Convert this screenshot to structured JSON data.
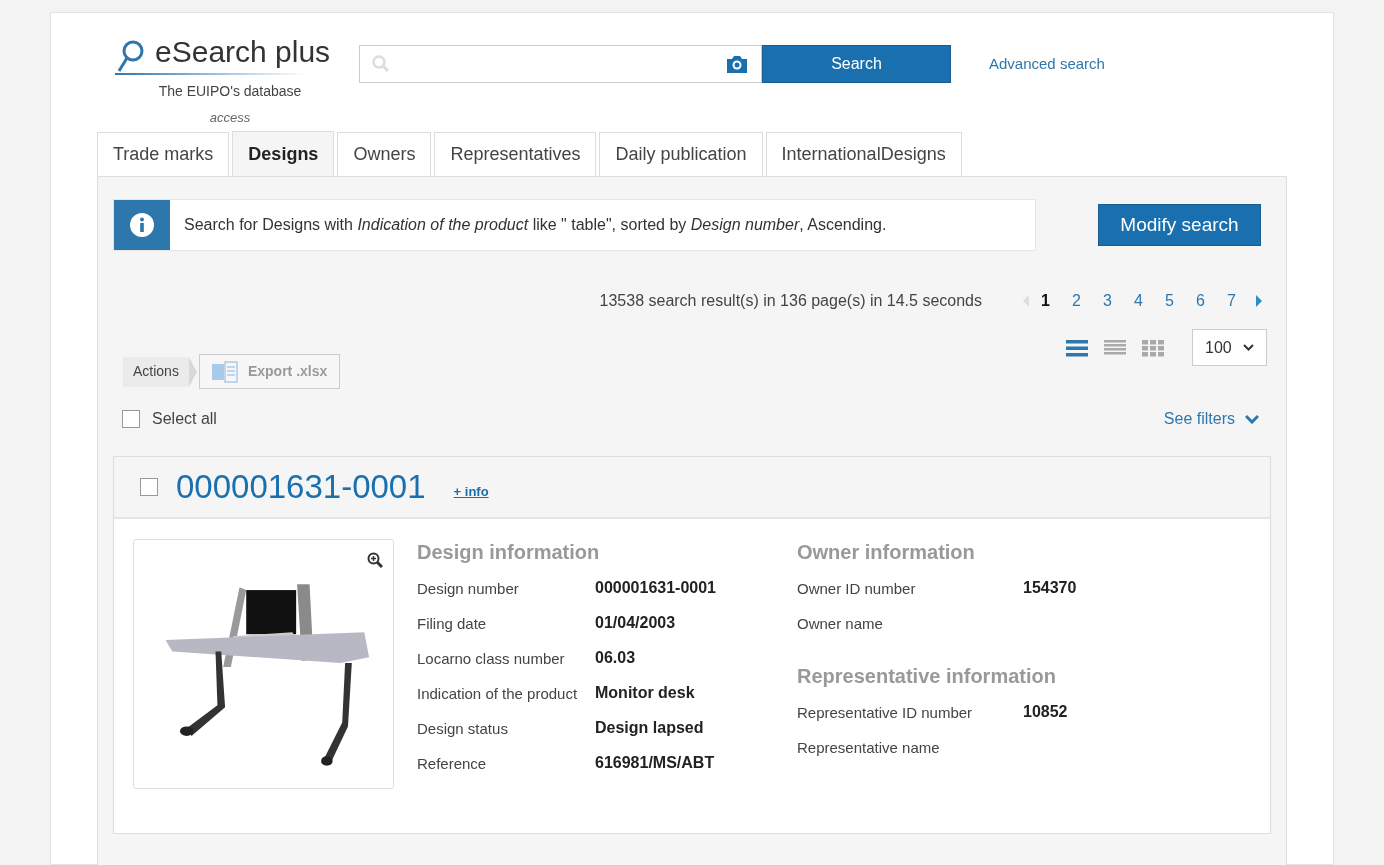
{
  "logo": {
    "title": "eSearch plus",
    "subtitle": "The EUIPO's database",
    "subtitle2": "access"
  },
  "search": {
    "button": "Search",
    "advanced": "Advanced search"
  },
  "tabs": [
    {
      "label": "Trade marks",
      "selected": false
    },
    {
      "label": "Designs",
      "selected": true
    },
    {
      "label": "Owners",
      "selected": false
    },
    {
      "label": "Representatives",
      "selected": false
    },
    {
      "label": "Daily publication",
      "selected": false
    },
    {
      "label": "InternationalDesigns",
      "selected": false
    }
  ],
  "info": {
    "text": "Search for Designs with *Indication of the product* like \" table\", sorted by *Design number*, Ascending.",
    "button": "Modify search"
  },
  "results": {
    "summary": "13538 search result(s) in 136 page(s) in 14.5 seconds",
    "pages": [
      {
        "label": "1",
        "selected": true
      },
      {
        "label": "2",
        "selected": false
      },
      {
        "label": "3",
        "selected": false
      },
      {
        "label": "4",
        "selected": false
      },
      {
        "label": "5",
        "selected": false
      },
      {
        "label": "6",
        "selected": false
      },
      {
        "label": "7",
        "selected": false
      }
    ],
    "views": [
      {
        "kind": "list",
        "selected": true
      },
      {
        "kind": "compact",
        "selected": false
      },
      {
        "kind": "grid",
        "selected": false
      }
    ],
    "page_size": "100"
  },
  "actions": {
    "label": "Actions",
    "export": "Export .xlsx",
    "export_disabled": true
  },
  "select_all": {
    "label": "Select all",
    "checked": false
  },
  "filters": "See filters",
  "result": {
    "number": "000001631-0001",
    "checked": false,
    "more": "+ info",
    "columns": [
      [
        {
          "title": "Design information",
          "rows": [
            {
              "label": "Design number",
              "value": "000001631-0001"
            },
            {
              "label": "Filing date",
              "value": "01/04/2003"
            },
            {
              "label": "Locarno class number",
              "value": "06.03"
            },
            {
              "label": "Indication of the product",
              "value": "Monitor desk"
            },
            {
              "label": "Design status",
              "value": "Design lapsed"
            },
            {
              "label": "Reference",
              "value": "616981/MS/ABT"
            }
          ]
        }
      ],
      [
        {
          "title": "Owner information",
          "rows": [
            {
              "label": "Owner ID number",
              "value": "154370"
            },
            {
              "label": "Owner name"
            }
          ]
        },
        {
          "title": "Representative information",
          "rows": [
            {
              "label": "Representative ID number",
              "value": "10852"
            },
            {
              "label": "Representative name"
            }
          ]
        }
      ]
    ]
  }
}
